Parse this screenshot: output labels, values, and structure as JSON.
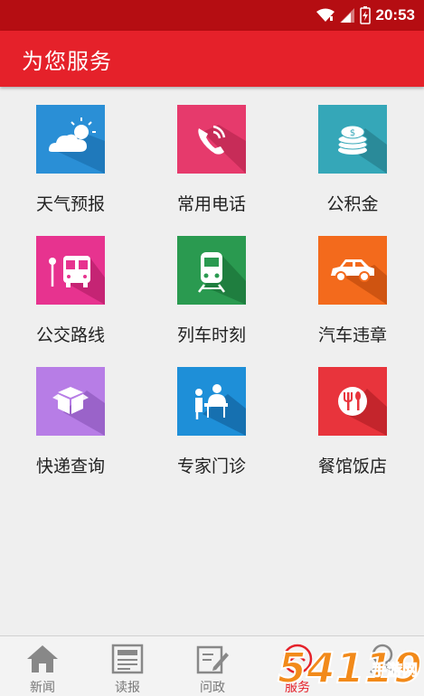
{
  "status": {
    "time": "20:53"
  },
  "appbar": {
    "title": "为您服务"
  },
  "services": [
    {
      "label": "天气预报",
      "icon": "weather-icon",
      "color": "#2a8fd6"
    },
    {
      "label": "常用电话",
      "icon": "phone-icon",
      "color": "#e63a6c"
    },
    {
      "label": "公积金",
      "icon": "coins-icon",
      "color": "#35a7b8"
    },
    {
      "label": "公交路线",
      "icon": "bus-icon",
      "color": "#e7338f"
    },
    {
      "label": "列车时刻",
      "icon": "train-icon",
      "color": "#2a9a50"
    },
    {
      "label": "汽车违章",
      "icon": "car-icon",
      "color": "#f36a1c"
    },
    {
      "label": "快递查询",
      "icon": "package-icon",
      "color": "#b77de6"
    },
    {
      "label": "专家门诊",
      "icon": "doctor-icon",
      "color": "#1e8fd8"
    },
    {
      "label": "餐馆饭店",
      "icon": "restaurant-icon",
      "color": "#e8343c"
    }
  ],
  "tabs": [
    {
      "label": "新闻",
      "icon": "home-icon"
    },
    {
      "label": "读报",
      "icon": "newspaper-icon"
    },
    {
      "label": "问政",
      "icon": "edit-icon"
    },
    {
      "label": "服务",
      "icon": "service-icon"
    },
    {
      "label": "",
      "icon": "search-icon"
    }
  ],
  "watermark": {
    "text": "54119",
    "subtext": "手游网"
  }
}
